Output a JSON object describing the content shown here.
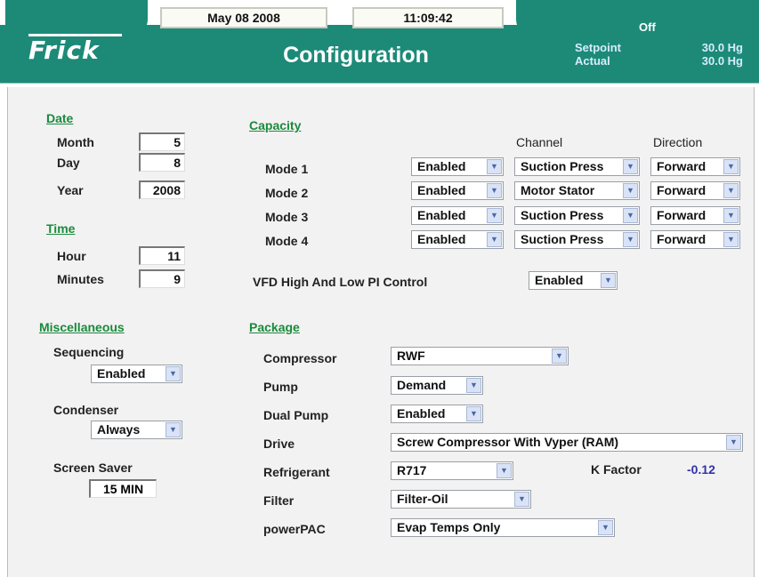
{
  "header": {
    "logo": "Frick",
    "date": "May 08 2008",
    "time": "11:09:42",
    "title": "Configuration",
    "status": "Off",
    "setpoint_label": "Setpoint",
    "setpoint_value": "30.0 Hg",
    "actual_label": "Actual",
    "actual_value": "30.0 Hg"
  },
  "date_section": {
    "heading": "Date",
    "month_label": "Month",
    "month": "5",
    "day_label": "Day",
    "day": "8",
    "year_label": "Year",
    "year": "2008"
  },
  "time_section": {
    "heading": "Time",
    "hour_label": "Hour",
    "hour": "11",
    "minutes_label": "Minutes",
    "minutes": "9"
  },
  "misc": {
    "heading": "Miscellaneous",
    "sequencing_label": "Sequencing",
    "sequencing": "Enabled",
    "condenser_label": "Condenser",
    "condenser": "Always",
    "screensaver_label": "Screen Saver",
    "screensaver": "15 MIN"
  },
  "capacity": {
    "heading": "Capacity",
    "channel_header": "Channel",
    "direction_header": "Direction",
    "modes": [
      {
        "label": "Mode 1",
        "enable": "Enabled",
        "channel": "Suction Press",
        "direction": "Forward"
      },
      {
        "label": "Mode 2",
        "enable": "Enabled",
        "channel": "Motor Stator",
        "direction": "Forward"
      },
      {
        "label": "Mode 3",
        "enable": "Enabled",
        "channel": "Suction Press",
        "direction": "Forward"
      },
      {
        "label": "Mode 4",
        "enable": "Enabled",
        "channel": "Suction Press",
        "direction": "Forward"
      }
    ],
    "vfd_label": "VFD High And Low PI Control",
    "vfd_value": "Enabled"
  },
  "package": {
    "heading": "Package",
    "compressor_label": "Compressor",
    "compressor": "RWF",
    "pump_label": "Pump",
    "pump": "Demand",
    "dual_pump_label": "Dual Pump",
    "dual_pump": "Enabled",
    "drive_label": "Drive",
    "drive": "Screw Compressor With Vyper (RAM)",
    "refrigerant_label": "Refrigerant",
    "refrigerant": "R717",
    "kfactor_label": "K Factor",
    "kfactor": "-0.12",
    "filter_label": "Filter",
    "filter": "Filter-Oil",
    "powerpac_label": "powerPAC",
    "powerpac": "Evap Temps Only"
  },
  "icons": {
    "dropdown": "chevron-down-icon"
  },
  "colors": {
    "header": "#1d8a78",
    "section": "#1a8a3c",
    "kfactor": "#3333aa"
  }
}
